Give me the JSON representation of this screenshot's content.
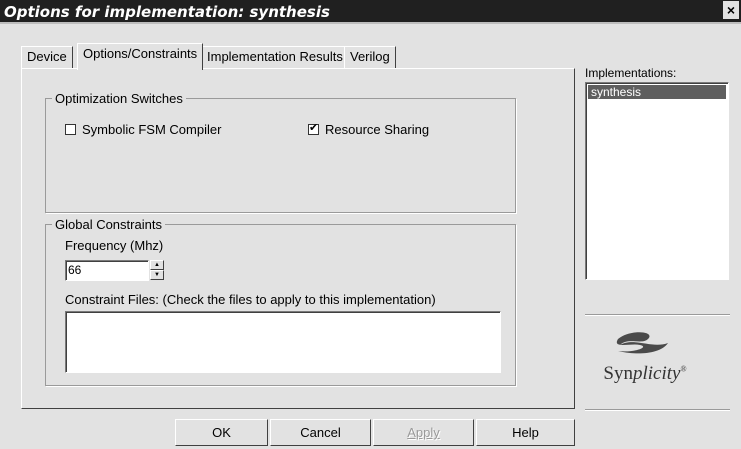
{
  "window": {
    "title": "Options for implementation: synthesis",
    "close_glyph": "×"
  },
  "tabs": [
    {
      "label": "Device"
    },
    {
      "label": "Options/Constraints"
    },
    {
      "label": "Implementation Results"
    },
    {
      "label": "Verilog"
    }
  ],
  "optimization": {
    "group_label": "Optimization Switches",
    "symbolic_fsm": {
      "label": "Symbolic FSM Compiler",
      "checked": false
    },
    "resource_sharing": {
      "label": "Resource Sharing",
      "checked": true
    }
  },
  "constraints": {
    "group_label": "Global Constraints",
    "frequency_label": "Frequency (Mhz)",
    "frequency_value": "66",
    "constraint_files_label": "Constraint Files:   (Check the files to apply to this implementation)",
    "constraint_files": []
  },
  "implementations": {
    "label": "Implementations:",
    "items": [
      "synthesis"
    ],
    "selected": "synthesis"
  },
  "logo": {
    "text_prefix": "Syn",
    "text_italic": "plicity",
    "mark": "®"
  },
  "buttons": {
    "ok": "OK",
    "cancel": "Cancel",
    "apply": "Apply",
    "help": "Help"
  },
  "colors": {
    "titlebar": "#202020",
    "selection": "#5e5e5e",
    "face": "#e2e2e2"
  }
}
